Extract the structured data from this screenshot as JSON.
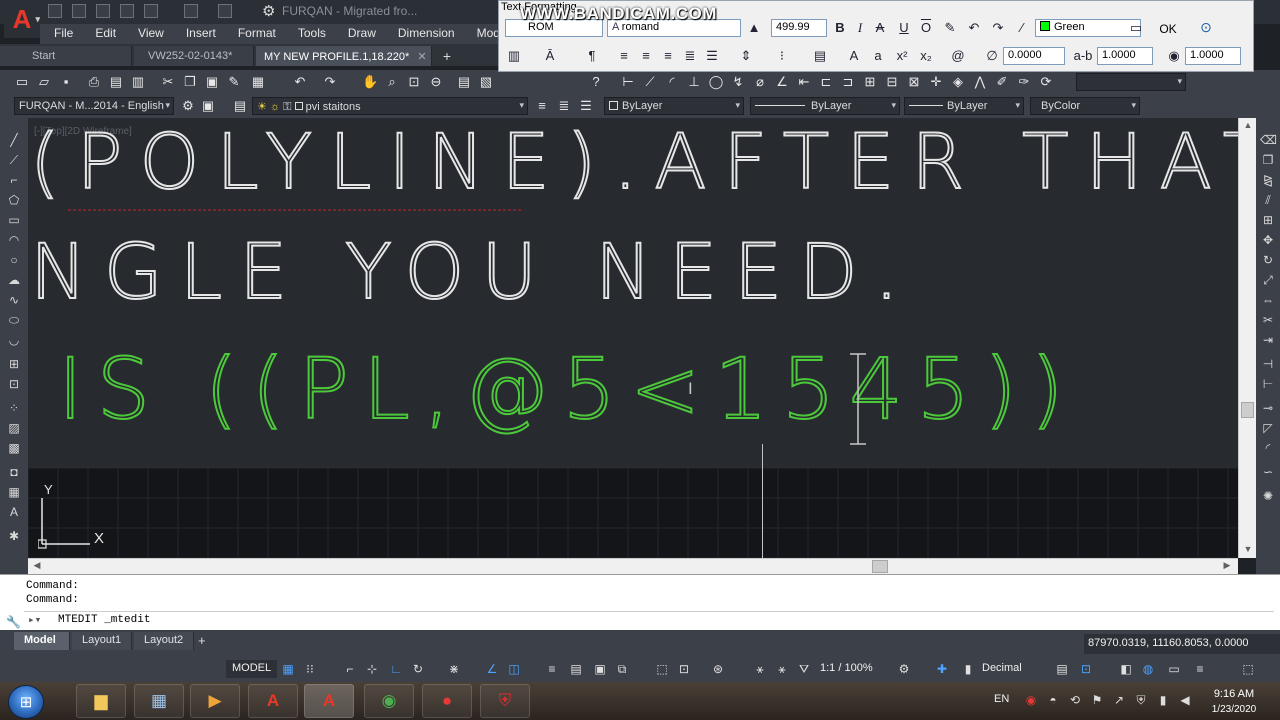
{
  "app": {
    "logo_letter": "A",
    "title": "FURQAN - Migrated fro..."
  },
  "menu": [
    "File",
    "Edit",
    "View",
    "Insert",
    "Format",
    "Tools",
    "Draw",
    "Dimension",
    "Modif"
  ],
  "doc_tabs": [
    {
      "label": "Start"
    },
    {
      "label": "VW252-02-0143*"
    },
    {
      "label": "MY NEW PROFILE.1,18.220*"
    }
  ],
  "text_formatting": {
    "title": "Text Formatting",
    "style": "ROM",
    "font": "romand",
    "font_prefix": "A",
    "height": "499.99",
    "color_name": "Green",
    "color_hex": "#00ff00",
    "ok_label": "OK",
    "oblique_value": "0.0000",
    "tracking_value": "1.0000",
    "width_value": "1.0000",
    "bold_glyph": "B",
    "italic_glyph": "I",
    "strike_glyph": "A",
    "underline_glyph": "U",
    "overline_glyph": "O"
  },
  "watermark": "WWW.BANDICAM.COM",
  "properties_bar": {
    "workspace": "FURQAN - M...2014 - English",
    "layer": "pvi staitons",
    "color": "ByLayer",
    "linetype": "ByLayer",
    "lineweight": "ByLayer",
    "plotstyle": "ByColor"
  },
  "viewport_label": "[-][Top][2D Wireframe]",
  "drawing_text": {
    "line1": "(POLYLINE).AFTER THAT",
    "line2": "NGLE YOU NEED.",
    "mtext_editing": "IS ((PL,@5<1545))",
    "mtext_color": "#4cc93a",
    "text_color": "#e6e6e6"
  },
  "ucs": {
    "x_label": "X",
    "y_label": "Y"
  },
  "command": {
    "history": [
      "Command:",
      "Command:"
    ],
    "current": "MTEDIT _mtedit"
  },
  "layout_tabs": [
    "Model",
    "Layout1",
    "Layout2"
  ],
  "coordinates": "87970.0319, 11160.8053, 0.0000",
  "status": {
    "model_label": "MODEL",
    "scale": "1:1 / 100%",
    "units": "Decimal"
  },
  "taskbar": {
    "lang": "EN",
    "time": "9:16 AM",
    "date": "1/23/2020"
  }
}
